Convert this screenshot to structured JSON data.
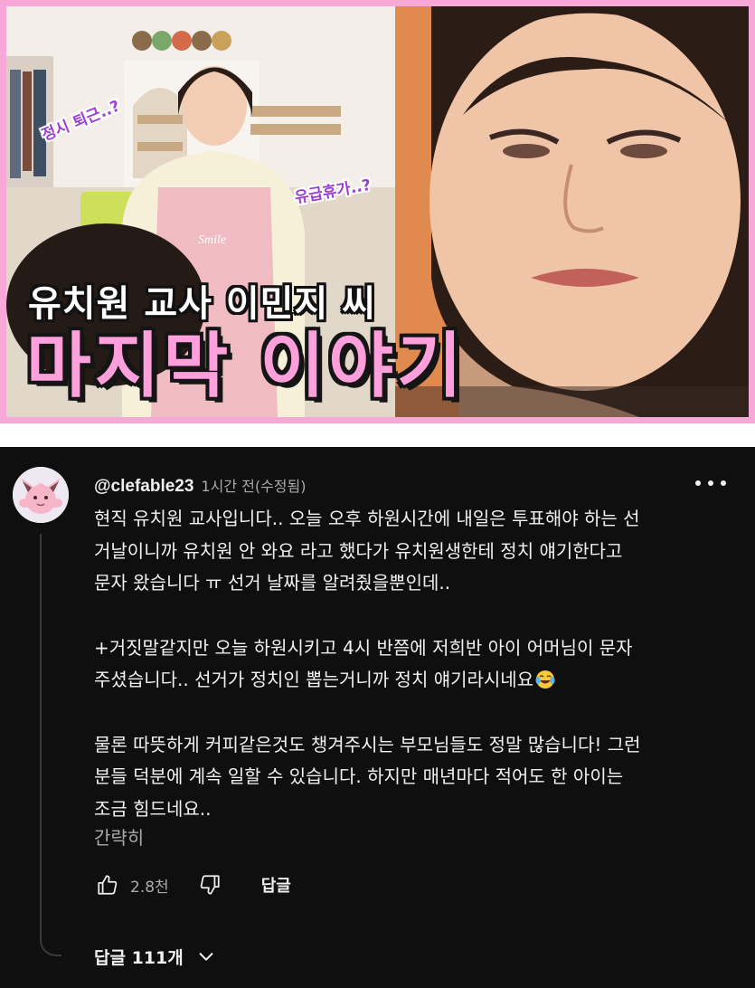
{
  "thumbnail": {
    "bubble_left": "정시 퇴근..?",
    "bubble_right": "유급휴가..?",
    "apron_text": "Smile",
    "caption_line1": "유치원 교사 이민지 씨",
    "caption_line2": "마지막 이야기",
    "colors": {
      "border": "#f7a8d6",
      "caption_pink": "#ff9fdc",
      "bubble_purple": "#9b3fd4"
    }
  },
  "comment": {
    "author": "@clefable23",
    "meta": "1시간 전(수정됨)",
    "paragraphs": [
      "현직 유치원 교사입니다.. 오늘 오후 하원시간에 내일은 투표해야 하는 선\n거날이니까 유치원 안 와요 라고 했다가 유치원생한테 정치 얘기한다고\n문자 왔습니다 ㅠ 선거 날짜를 알려줬을뿐인데..",
      "+거짓말같지만 오늘 하원시키고 4시 반쯤에 저희반 아이 어머님이 문자\n주셨습니다.. 선거가 정치인 뽑는거니까 정치 얘기라시네요",
      "물론 따뜻하게 커피같은것도 챙겨주시는 부모님들도 정말 많습니다! 그런\n분들 덕분에 계속 일할 수 있습니다. 하지만 매년마다 적어도 한 아이는\n조금 힘드네요.."
    ],
    "show_less": "간략히",
    "like_count": "2.8천",
    "reply_label": "답글",
    "replies_toggle": "답글 111개",
    "icons": {
      "more": "more-vert-icon",
      "like": "thumbs-up-icon",
      "dislike": "thumbs-down-icon",
      "expand": "chevron-down-icon",
      "emoji": "laughing-tears-emoji"
    },
    "colors": {
      "background": "#0f0f0f",
      "text": "#f1f1f1",
      "muted": "#aaaaaa"
    }
  }
}
